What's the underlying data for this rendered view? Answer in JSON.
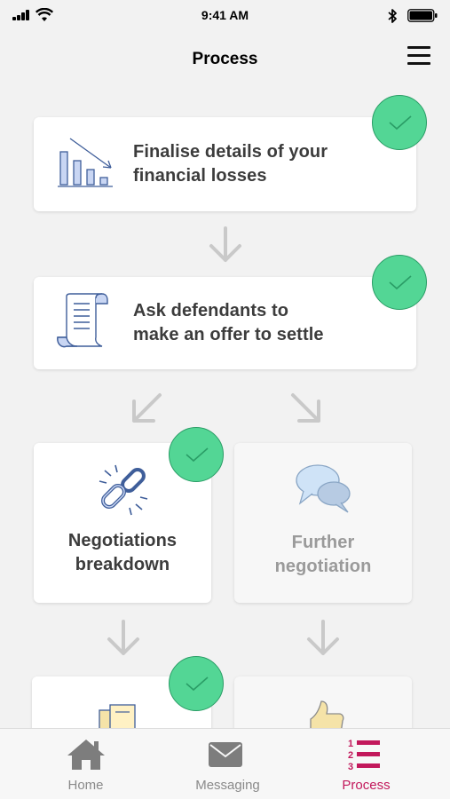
{
  "status_bar": {
    "time": "9:41 AM"
  },
  "header": {
    "title": "Process"
  },
  "steps": [
    {
      "label_line1": "Finalise details of your",
      "label_line2": "financial losses",
      "completed": true,
      "icon": "bar-chart-decline-icon"
    },
    {
      "label_line1": "Ask defendants to",
      "label_line2": "make an offer to settle",
      "completed": true,
      "icon": "scroll-document-icon"
    },
    {
      "label_line1": "Negotiations",
      "label_line2": "breakdown",
      "completed": true,
      "icon": "broken-chain-icon"
    },
    {
      "label_line1": "Further",
      "label_line2": "negotiation",
      "completed": false,
      "icon": "speech-bubbles-icon"
    },
    {
      "completed": true,
      "icon": "documents-icon"
    },
    {
      "completed": false,
      "icon": "thumbs-up-icon"
    }
  ],
  "tabbar": {
    "items": [
      {
        "label": "Home",
        "icon": "home-icon",
        "active": false
      },
      {
        "label": "Messaging",
        "icon": "envelope-icon",
        "active": false
      },
      {
        "label": "Process",
        "icon": "numbered-list-icon",
        "active": true
      }
    ]
  },
  "colors": {
    "accent": "#c2185b",
    "check": "#53d695",
    "check_border": "#2a9d66",
    "icon_blue": "#3f5e9a"
  }
}
